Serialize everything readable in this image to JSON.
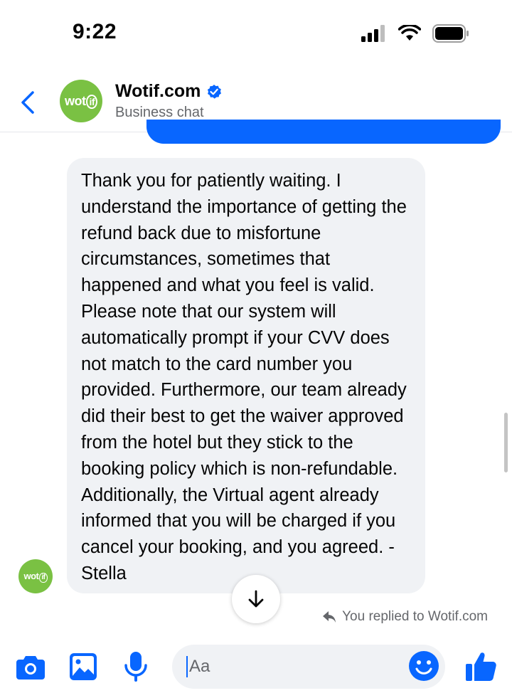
{
  "status_bar": {
    "time": "9:22"
  },
  "header": {
    "logo_text": "wot",
    "logo_ring": "if",
    "name": "Wotif.com",
    "subtitle": "Business chat"
  },
  "message": {
    "text": "Thank you for patiently waiting. I understand the importance of getting the refund back due to misfortune circumstances, sometimes that happened and what you feel is valid. Please note that our system will automatically prompt if your CVV does not match to the card number you provided. Furthermore, our team already did their best to get the waiver approved from the hotel but they stick to the booking policy which is non-refundable. Additionally, the Virtual agent already informed that you will be charged if you cancel your booking, and you agreed. -Stella"
  },
  "reply_note": "You replied to Wotif.com",
  "composer": {
    "placeholder": "Aa"
  },
  "icons": {
    "back": "back-chevron-icon",
    "verified": "verified-badge-icon",
    "camera": "camera-icon",
    "gallery": "image-gallery-icon",
    "mic": "microphone-icon",
    "emoji": "emoji-icon",
    "like": "thumbs-up-icon",
    "scroll_down": "arrow-down-icon",
    "reply": "reply-arrow-icon"
  },
  "colors": {
    "accent": "#0866ff",
    "brand_green": "#7ac143",
    "bubble_gray": "#f0f2f5",
    "secondary_text": "#65676b"
  }
}
